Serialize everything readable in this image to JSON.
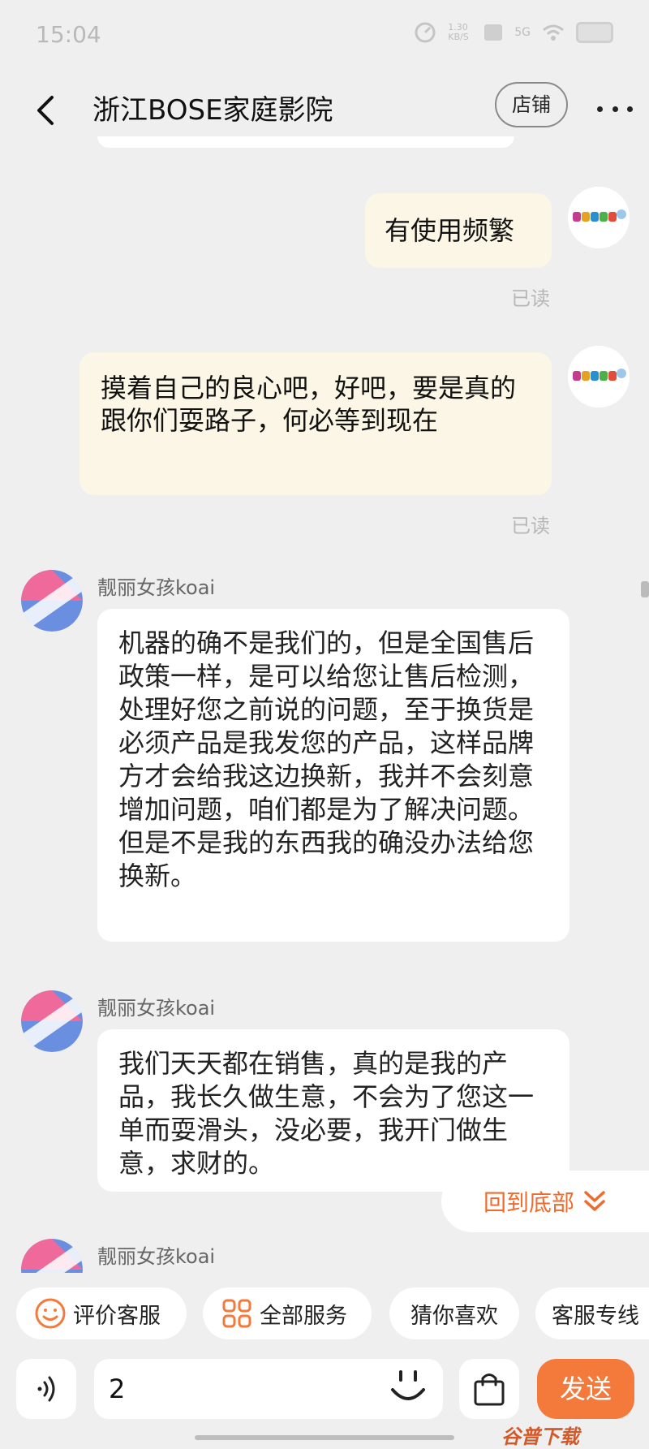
{
  "status_bar": {
    "time": "15:04",
    "speed": "1.30 KB/S",
    "network": "5G"
  },
  "header": {
    "title": "浙江BOSE家庭影院",
    "store_button": "店铺"
  },
  "messages": {
    "out1": {
      "text": "有使用频繁",
      "read": "已读"
    },
    "out2": {
      "text": "摸着自己的良心吧，好吧，要是真的跟你们耍路子，何必等到现在",
      "read": "已读"
    },
    "in1": {
      "sender": "靓丽女孩koai",
      "text": "机器的确不是我们的，但是全国售后政策一样，是可以给您让售后检测，处理好您之前说的问题，至于换货是必须产品是我发您的产品，这样品牌方才会给我这边换新，我并不会刻意增加问题，咱们都是为了解决问题。但是不是我的东西我的确没办法给您换新。"
    },
    "in2": {
      "sender": "靓丽女孩koai",
      "text": "我们天天都在销售，真的是我的产品，我长久做生意，不会为了您这一单而耍滑头，没必要，我开门做生意，求财的。"
    },
    "in3": {
      "sender": "靓丽女孩koai"
    }
  },
  "back_to_bottom": "回到底部",
  "quick_services": [
    "评价客服",
    "全部服务",
    "猜你喜欢",
    "客服专线"
  ],
  "input": {
    "value": "2"
  },
  "send_label": "发送",
  "watermark": "谷普下载",
  "colors": {
    "accent": "#f47a3b",
    "bubble_out": "#fbf6e5",
    "bubble_in": "#ffffff",
    "background": "#efefef"
  }
}
